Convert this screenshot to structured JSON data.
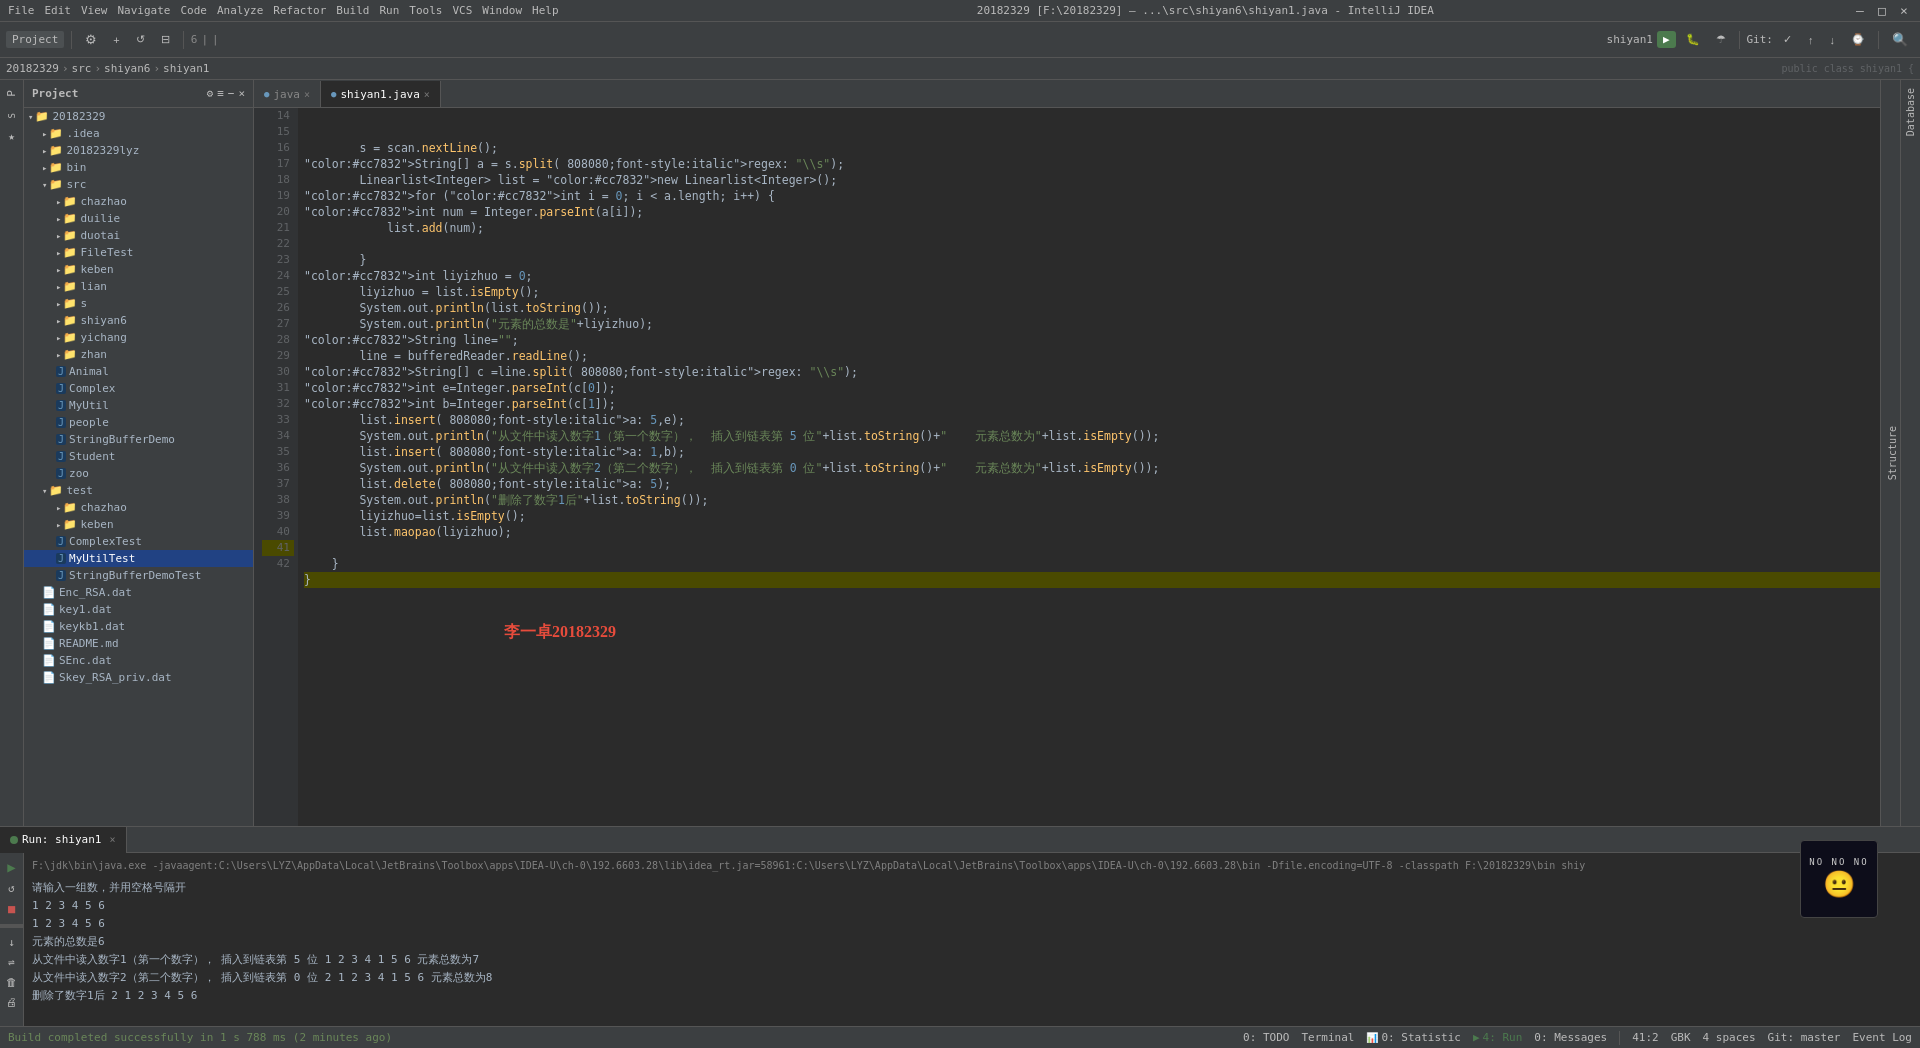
{
  "titlebar": {
    "title": "20182329 [F:\\20182329] – ...\\src\\shiyan6\\shiyan1.java - IntelliJ IDEA",
    "menu_items": [
      "File",
      "Edit",
      "View",
      "Navigate",
      "Code",
      "Analyze",
      "Refactor",
      "Build",
      "Run",
      "Tools",
      "VCS",
      "Window",
      "Help"
    ],
    "controls": [
      "—",
      "□",
      "×"
    ]
  },
  "breadcrumb": {
    "project": "20182329",
    "src": "src",
    "package": "shiyan6",
    "file": "shiyan1"
  },
  "toolbar": {
    "project_label": "Project",
    "run_config": "shiyan1",
    "git_label": "Git:"
  },
  "tabs": [
    {
      "label": "java",
      "active": false
    },
    {
      "label": "shiyan1.java",
      "active": true
    }
  ],
  "project_tree": [
    {
      "label": "20182329",
      "depth": 0,
      "type": "project",
      "expanded": true
    },
    {
      "label": ".idea",
      "depth": 1,
      "type": "folder",
      "expanded": false
    },
    {
      "label": "20182329lyz",
      "depth": 1,
      "type": "folder",
      "expanded": false
    },
    {
      "label": "bin",
      "depth": 1,
      "type": "folder",
      "expanded": false
    },
    {
      "label": "src",
      "depth": 1,
      "type": "folder",
      "expanded": true
    },
    {
      "label": "chazhao",
      "depth": 2,
      "type": "folder",
      "expanded": false
    },
    {
      "label": "duilie",
      "depth": 2,
      "type": "folder",
      "expanded": false
    },
    {
      "label": "duotai",
      "depth": 2,
      "type": "folder",
      "expanded": false
    },
    {
      "label": "FileTest",
      "depth": 2,
      "type": "folder",
      "expanded": false
    },
    {
      "label": "keben",
      "depth": 2,
      "type": "folder",
      "expanded": false
    },
    {
      "label": "lian",
      "depth": 2,
      "type": "folder",
      "expanded": false
    },
    {
      "label": "s",
      "depth": 2,
      "type": "folder",
      "expanded": false
    },
    {
      "label": "shiyan6",
      "depth": 2,
      "type": "folder",
      "expanded": false
    },
    {
      "label": "yichang",
      "depth": 2,
      "type": "folder",
      "expanded": false
    },
    {
      "label": "zhan",
      "depth": 2,
      "type": "folder",
      "expanded": false
    },
    {
      "label": "Animal",
      "depth": 2,
      "type": "java",
      "expanded": false
    },
    {
      "label": "Complex",
      "depth": 2,
      "type": "java",
      "expanded": false
    },
    {
      "label": "MyUtil",
      "depth": 2,
      "type": "java",
      "expanded": false
    },
    {
      "label": "people",
      "depth": 2,
      "type": "java",
      "expanded": false
    },
    {
      "label": "StringBufferDemo",
      "depth": 2,
      "type": "java",
      "expanded": false
    },
    {
      "label": "Student",
      "depth": 2,
      "type": "java",
      "expanded": false
    },
    {
      "label": "zoo",
      "depth": 2,
      "type": "java",
      "expanded": false
    },
    {
      "label": "test",
      "depth": 1,
      "type": "folder",
      "expanded": true
    },
    {
      "label": "chazhao",
      "depth": 2,
      "type": "folder",
      "expanded": false
    },
    {
      "label": "keben",
      "depth": 2,
      "type": "folder",
      "expanded": false
    },
    {
      "label": "ComplexTest",
      "depth": 2,
      "type": "java",
      "expanded": false
    },
    {
      "label": "MyUtilTest",
      "depth": 2,
      "type": "java",
      "expanded": false,
      "selected": true
    },
    {
      "label": "StringBufferDemoTest",
      "depth": 2,
      "type": "java",
      "expanded": false
    },
    {
      "label": "Enc_RSA.dat",
      "depth": 1,
      "type": "file"
    },
    {
      "label": "key1.dat",
      "depth": 1,
      "type": "file"
    },
    {
      "label": "keykb1.dat",
      "depth": 1,
      "type": "file"
    },
    {
      "label": "README.md",
      "depth": 1,
      "type": "file"
    },
    {
      "label": "SEnc.dat",
      "depth": 1,
      "type": "file"
    },
    {
      "label": "Skey_RSA_priv.dat",
      "depth": 1,
      "type": "file"
    }
  ],
  "code_lines": [
    {
      "num": 14,
      "content": "        s = scan.nextLine();"
    },
    {
      "num": 15,
      "content": "        String[] a = s.split( regex: \"\\\\s\");"
    },
    {
      "num": 16,
      "content": "        Linearlist<Integer> list = new Linearlist<Integer>();"
    },
    {
      "num": 17,
      "content": "        for (int i = 0; i < a.length; i++) {"
    },
    {
      "num": 18,
      "content": "            int num = Integer.parseInt(a[i]);"
    },
    {
      "num": 19,
      "content": "            list.add(num);"
    },
    {
      "num": 20,
      "content": ""
    },
    {
      "num": 21,
      "content": "        }"
    },
    {
      "num": 22,
      "content": "        int liyizhuo = 0;"
    },
    {
      "num": 23,
      "content": "        liyizhuo = list.isEmpty();"
    },
    {
      "num": 24,
      "content": "        System.out.println(list.toString());"
    },
    {
      "num": 25,
      "content": "        System.out.println(\"元素的总数是\"+liyizhuo);"
    },
    {
      "num": 26,
      "content": "        String line=\"\";"
    },
    {
      "num": 27,
      "content": "        line = bufferedReader.readLine();"
    },
    {
      "num": 28,
      "content": "        String[] c =line.split( regex: \"\\\\s\");"
    },
    {
      "num": 29,
      "content": "        int e=Integer.parseInt(c[0]);"
    },
    {
      "num": 30,
      "content": "        int b=Integer.parseInt(c[1]);"
    },
    {
      "num": 31,
      "content": "        list.insert( a: 5,e);"
    },
    {
      "num": 32,
      "content": "        System.out.println(\"从文件中读入数字1（第一个数字），  插入到链表第 5 位\"+list.toString()+\"    元素总数为\"+list.isEmpty());"
    },
    {
      "num": 33,
      "content": "        list.insert( a: 1,b);"
    },
    {
      "num": 34,
      "content": "        System.out.println(\"从文件中读入数字2（第二个数字），  插入到链表第 0 位\"+list.toString()+\"    元素总数为\"+list.isEmpty());"
    },
    {
      "num": 35,
      "content": "        list.delete( a: 5);"
    },
    {
      "num": 36,
      "content": "        System.out.println(\"删除了数字1后\"+list.toString());"
    },
    {
      "num": 37,
      "content": "        liyizhuo=list.isEmpty();"
    },
    {
      "num": 38,
      "content": "        list.maopao(liyizhuo);"
    },
    {
      "num": 39,
      "content": ""
    },
    {
      "num": 40,
      "content": "    }"
    },
    {
      "num": 41,
      "content": "}",
      "highlighted": true
    },
    {
      "num": 42,
      "content": ""
    }
  ],
  "watermark": "李一卓20182329",
  "run_panel": {
    "tab_label": "Run: shiyan1",
    "cmd_line": "F:\\jdk\\bin\\java.exe -javaagent:C:\\Users\\LYZ\\AppData\\Local\\JetBrains\\Toolbox\\apps\\IDEA-U\\ch-0\\192.6603.28\\lib\\idea_rt.jar=58961:C:\\Users\\LYZ\\AppData\\Local\\JetBrains\\Toolbox\\apps\\IDEA-U\\ch-0\\192.6603.28\\bin -Dfile.encoding=UTF-8 -classpath F:\\20182329\\bin shiy",
    "output_lines": [
      "请输入一组数，并用空格号隔开",
      "1 2 3 4 5 6",
      "   1   2   3   4   5   6",
      "元素的总数是6",
      "从文件中读入数字1（第一个数字），  插入到链表第 5 位  1  2  3  4  1  5  6   元素总数为7",
      "从文件中读入数字2（第二个数字），  插入到链表第 0 位  2  1  2  3  4  1  5  6   元素总数为8",
      "删除了数字1后  2  1  2  3  4  5  6"
    ]
  },
  "statusbar": {
    "todo": "0: TODO",
    "terminal": "Terminal",
    "statistic": "0: Statistic",
    "run": "4: Run",
    "messages": "0: Messages",
    "position": "41:2",
    "encoding": "GBK",
    "indent": "4 spaces",
    "git": "Git: master",
    "event_log": "Event Log",
    "build_msg": "Build completed successfully in 1 s 788 ms (2 minutes ago)"
  },
  "right_panel": {
    "label": "Database"
  },
  "structure_label": "Structure"
}
